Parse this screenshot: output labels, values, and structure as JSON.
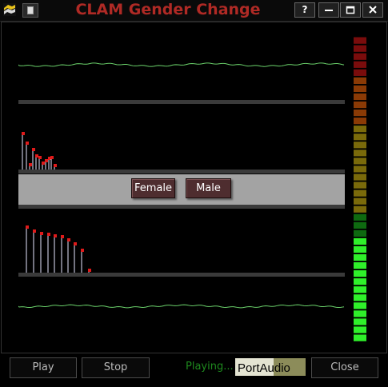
{
  "window": {
    "title": "CLAM Gender Change",
    "buttons": {
      "help": "?",
      "minimize": "▬",
      "maximize": "□",
      "close": "✕"
    }
  },
  "controls": {
    "female_label": "Female",
    "male_label": "Male"
  },
  "footer": {
    "play_label": "Play",
    "stop_label": "Stop",
    "status": "Playing...",
    "logo_text": "PortAudio",
    "close_label": "Close"
  },
  "vu_meter": {
    "segments": 38,
    "level_fraction": 0.34,
    "colors": {
      "dim_red": "#7a0c0c",
      "dim_orange": "#8a3a05",
      "dim_yellow": "#7a6a0a",
      "dim_green": "#0e6a10",
      "lit_green": "#2ff02a"
    }
  },
  "colors": {
    "waveform": "#6bd26b",
    "peak_line": "#e6e6ff",
    "peak_marker": "#e01a1a",
    "accent_title": "#b02a25"
  }
}
